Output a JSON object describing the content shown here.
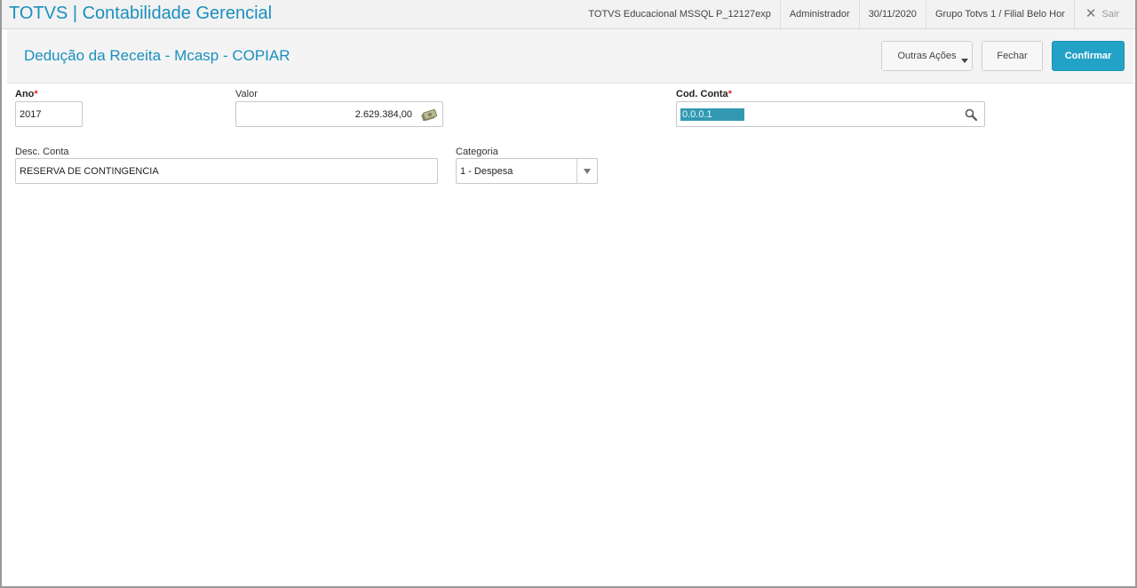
{
  "app": {
    "title": "TOTVS | Contabilidade Gerencial",
    "environment": "TOTVS Educacional MSSQL P_12127exp",
    "user": "Administrador",
    "date": "30/11/2020",
    "company": "Grupo Totvs 1 / Filial Belo Hor",
    "exit_label": "Sair"
  },
  "header": {
    "title": "Dedução da Receita - Mcasp - COPIAR",
    "other_actions_label": "Outras Ações",
    "close_label": "Fechar",
    "confirm_label": "Confirmar"
  },
  "form": {
    "ano": {
      "label": "Ano",
      "required_mark": "*",
      "value": "2017"
    },
    "valor": {
      "label": "Valor",
      "value": "2.629.384,00"
    },
    "cod_conta": {
      "label": "Cod. Conta",
      "required_mark": "*",
      "value": "0.0.0.1"
    },
    "desc_conta": {
      "label": "Desc. Conta",
      "value": "RESERVA DE CONTINGENCIA"
    },
    "categoria": {
      "label": "Categoria",
      "value": "1 - Despesa"
    }
  },
  "colors": {
    "accent": "#1a8fbf",
    "confirm_button": "#22a2c7",
    "required": "#d8222a",
    "selection": "#3399b3"
  },
  "icons": {
    "valor": "money-icon",
    "cod_conta": "search-icon",
    "categoria": "chevron-down-icon",
    "exit": "close-icon"
  }
}
